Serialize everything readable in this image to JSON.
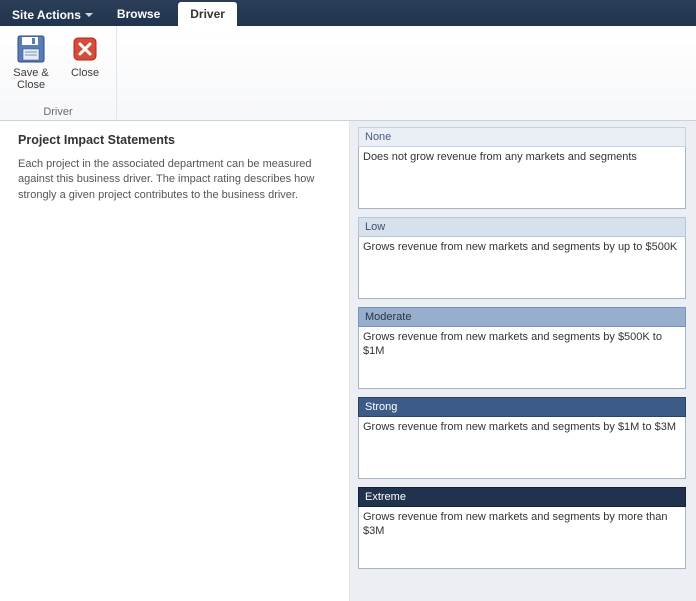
{
  "header": {
    "site_actions_label": "Site Actions",
    "tabs": {
      "browse": "Browse",
      "driver": "Driver"
    }
  },
  "ribbon": {
    "group_label": "Driver",
    "save_close_label": "Save & Close",
    "close_label": "Close"
  },
  "left": {
    "title": "Project Impact Statements",
    "description": "Each project in the associated department can be measured against this business driver. The impact rating describes how strongly a given project contributes to the business driver."
  },
  "impacts": {
    "none": {
      "label": "None",
      "text": "Does not grow revenue from any markets and segments"
    },
    "low": {
      "label": "Low",
      "text": "Grows revenue from new markets and segments by up to $500K"
    },
    "moderate": {
      "label": "Moderate",
      "text": "Grows revenue from new markets and segments by $500K to $1M"
    },
    "strong": {
      "label": "Strong",
      "text": "Grows revenue from new markets and segments by $1M to $3M"
    },
    "extreme": {
      "label": "Extreme",
      "text": "Grows revenue from new markets and segments by more than $3M"
    }
  }
}
